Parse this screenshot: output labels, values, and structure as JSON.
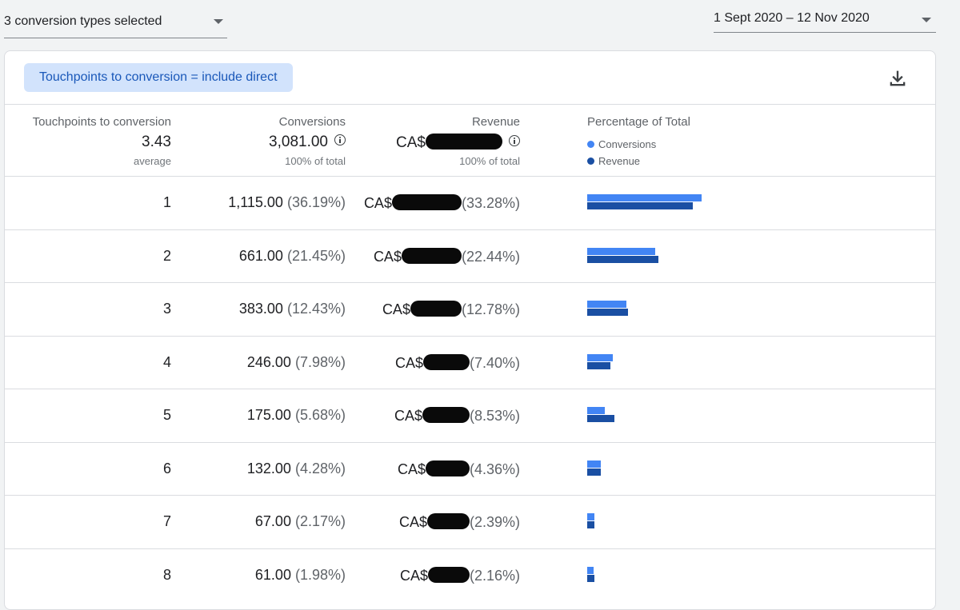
{
  "filters": {
    "conversion_types": "3 conversion types selected",
    "date_range": "1 Sept 2020 – 12 Nov 2020"
  },
  "chip": {
    "label": "Touchpoints to conversion = include direct"
  },
  "icons": {
    "download": "download-icon",
    "info": "info-icon",
    "dropdown": "arrow-drop-down-icon"
  },
  "colors": {
    "conversions": "#4285f4",
    "revenue": "#1a4fa3",
    "chip_bg": "#d2e3fc",
    "chip_text": "#1a58b9"
  },
  "summary": {
    "touchpoints": {
      "header": "Touchpoints to conversion",
      "value": "3.43",
      "sub": "average"
    },
    "conversions": {
      "header": "Conversions",
      "value": "3,081.00",
      "sub": "100% of total"
    },
    "revenue": {
      "header": "Revenue",
      "value_prefix": "CA$",
      "sub": "100% of total"
    },
    "percentage": {
      "header": "Percentage of Total",
      "legend_conversions": "Conversions",
      "legend_revenue": "Revenue"
    }
  },
  "rows": [
    {
      "tp": "1",
      "conv": "1,115.00",
      "conv_pct": "(36.19%)",
      "rev_prefix": "CA$",
      "rev_pct": "(33.28%)",
      "conv_share": 36.19,
      "rev_share": 33.28
    },
    {
      "tp": "2",
      "conv": "661.00",
      "conv_pct": "(21.45%)",
      "rev_prefix": "CA$",
      "rev_pct": "(22.44%)",
      "conv_share": 21.45,
      "rev_share": 22.44
    },
    {
      "tp": "3",
      "conv": "383.00",
      "conv_pct": "(12.43%)",
      "rev_prefix": "CA$",
      "rev_pct": "(12.78%)",
      "conv_share": 12.43,
      "rev_share": 12.78
    },
    {
      "tp": "4",
      "conv": "246.00",
      "conv_pct": "(7.98%)",
      "rev_prefix": "CA$",
      "rev_pct": "(7.40%)",
      "conv_share": 7.98,
      "rev_share": 7.4
    },
    {
      "tp": "5",
      "conv": "175.00",
      "conv_pct": "(5.68%)",
      "rev_prefix": "CA$",
      "rev_pct": "(8.53%)",
      "conv_share": 5.68,
      "rev_share": 8.53
    },
    {
      "tp": "6",
      "conv": "132.00",
      "conv_pct": "(4.28%)",
      "rev_prefix": "CA$",
      "rev_pct": "(4.36%)",
      "conv_share": 4.28,
      "rev_share": 4.36
    },
    {
      "tp": "7",
      "conv": "67.00",
      "conv_pct": "(2.17%)",
      "rev_prefix": "CA$",
      "rev_pct": "(2.39%)",
      "conv_share": 2.17,
      "rev_share": 2.39
    },
    {
      "tp": "8",
      "conv": "61.00",
      "conv_pct": "(1.98%)",
      "rev_prefix": "CA$",
      "rev_pct": "(2.16%)",
      "conv_share": 1.98,
      "rev_share": 2.16
    }
  ]
}
